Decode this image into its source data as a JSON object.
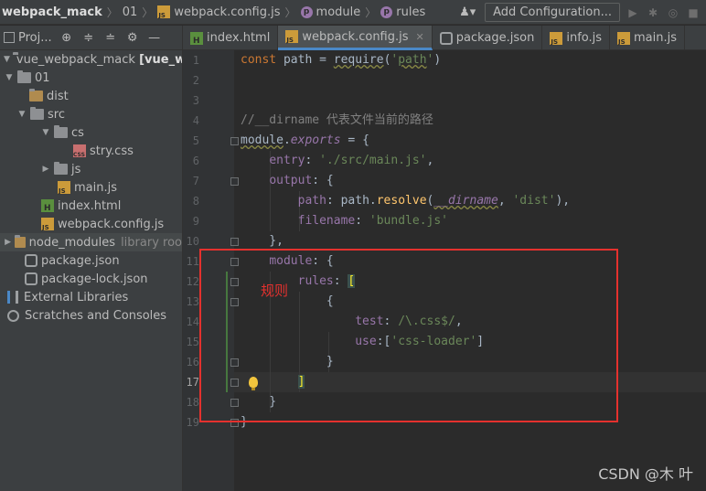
{
  "breadcrumb": [
    "webpack_mack",
    "01",
    "webpack.config.js",
    "module",
    "rules"
  ],
  "toolbar": {
    "add_configuration": "Add Configuration..."
  },
  "project_panel": {
    "label": "Proj..."
  },
  "tabs": [
    {
      "label": "index.html",
      "icon": "html"
    },
    {
      "label": "webpack.config.js",
      "icon": "js",
      "active": true
    },
    {
      "label": "package.json",
      "icon": "json"
    },
    {
      "label": "info.js",
      "icon": "js"
    },
    {
      "label": "main.js",
      "icon": "js"
    }
  ],
  "tree": {
    "root_label": "vue_webpack_mack",
    "root_suffix": "[vue_web",
    "items": [
      "01",
      "dist",
      "src",
      "cs",
      "stry.css",
      "js",
      "main.js",
      "index.html",
      "webpack.config.js",
      "node_modules",
      "package.json",
      "package-lock.json",
      "External Libraries",
      "Scratches and Consoles"
    ],
    "node_modules_hint": "library roo"
  },
  "code": {
    "line_numbers": [
      "1",
      "2",
      "3",
      "4",
      "5",
      "6",
      "7",
      "8",
      "9",
      "10",
      "11",
      "12",
      "13",
      "14",
      "15",
      "16",
      "17",
      "18",
      "19"
    ],
    "current_line": 17
  },
  "annotation": {
    "text": "规则"
  },
  "watermark": "CSDN @木 叶",
  "colors": {
    "accent": "#4a88c7",
    "annotation": "#e5312e",
    "keyword": "#cc7832",
    "string": "#6a8759",
    "property": "#9876aa"
  }
}
